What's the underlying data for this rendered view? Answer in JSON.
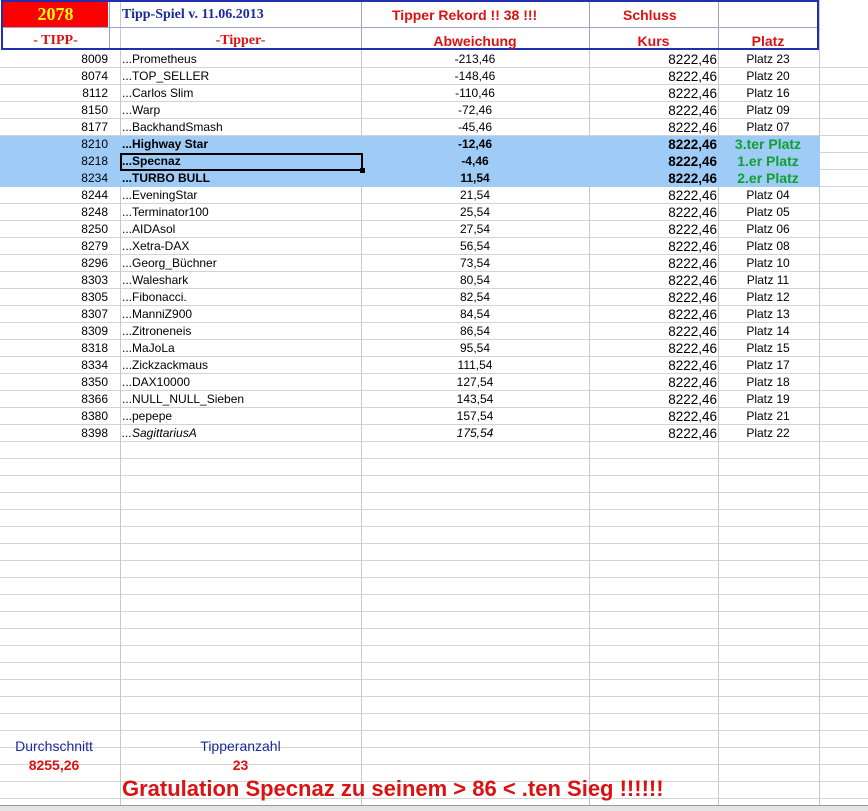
{
  "header": {
    "tipp_count_box": "2078",
    "title": "Tipp-Spiel v. 11.06.2013",
    "record": "Tipper Rekord !!  38  !!!",
    "close_label": "Schluss",
    "col_tipp": "- TIPP-",
    "col_tipper": "-Tipper-",
    "col_deviation": "Abweichung",
    "col_course": "Kurs",
    "col_place": "Platz"
  },
  "rows": [
    {
      "tipp": "8009",
      "name": "...Prometheus",
      "dev": "-213,46",
      "kurs": "8222,46",
      "platz": "Platz 23"
    },
    {
      "tipp": "8074",
      "name": "...TOP_SELLER",
      "dev": "-148,46",
      "kurs": "8222,46",
      "platz": "Platz 20"
    },
    {
      "tipp": "8112",
      "name": "...Carlos Slim",
      "dev": "-110,46",
      "kurs": "8222,46",
      "platz": "Platz 16"
    },
    {
      "tipp": "8150",
      "name": "...Warp",
      "dev": "-72,46",
      "kurs": "8222,46",
      "platz": "Platz 09"
    },
    {
      "tipp": "8177",
      "name": "...BackhandSmash",
      "dev": "-45,46",
      "kurs": "8222,46",
      "platz": "Platz 07"
    },
    {
      "tipp": "8210",
      "name": "...Highway Star",
      "dev": "-12,46",
      "kurs": "8222,46",
      "platz": "3.ter Platz"
    },
    {
      "tipp": "8218",
      "name": "...Specnaz",
      "dev": "-4,46",
      "kurs": "8222,46",
      "platz": "1.er Platz"
    },
    {
      "tipp": "8234",
      "name": "...TURBO BULL",
      "dev": "11,54",
      "kurs": "8222,46",
      "platz": "2.er Platz"
    },
    {
      "tipp": "8244",
      "name": "...EveningStar",
      "dev": "21,54",
      "kurs": "8222,46",
      "platz": "Platz 04"
    },
    {
      "tipp": "8248",
      "name": "...Terminator100",
      "dev": "25,54",
      "kurs": "8222,46",
      "platz": "Platz 05"
    },
    {
      "tipp": "8250",
      "name": "...AIDAsol",
      "dev": "27,54",
      "kurs": "8222,46",
      "platz": "Platz 06"
    },
    {
      "tipp": "8279",
      "name": "...Xetra-DAX",
      "dev": "56,54",
      "kurs": "8222,46",
      "platz": "Platz 08"
    },
    {
      "tipp": "8296",
      "name": "...Georg_Büchner",
      "dev": "73,54",
      "kurs": "8222,46",
      "platz": "Platz 10"
    },
    {
      "tipp": "8303",
      "name": "...Waleshark",
      "dev": "80,54",
      "kurs": "8222,46",
      "platz": "Platz 11"
    },
    {
      "tipp": "8305",
      "name": "...Fibonacci.",
      "dev": "82,54",
      "kurs": "8222,46",
      "platz": "Platz 12"
    },
    {
      "tipp": "8307",
      "name": "...ManniZ900",
      "dev": "84,54",
      "kurs": "8222,46",
      "platz": "Platz 13"
    },
    {
      "tipp": "8309",
      "name": "...Zitroneneis",
      "dev": "86,54",
      "kurs": "8222,46",
      "platz": "Platz 14"
    },
    {
      "tipp": "8318",
      "name": "...MaJoLa",
      "dev": "95,54",
      "kurs": "8222,46",
      "platz": "Platz 15"
    },
    {
      "tipp": "8334",
      "name": "...Zickzackmaus",
      "dev": "111,54",
      "kurs": "8222,46",
      "platz": "Platz 17"
    },
    {
      "tipp": "8350",
      "name": "...DAX10000",
      "dev": "127,54",
      "kurs": "8222,46",
      "platz": "Platz 18"
    },
    {
      "tipp": "8366",
      "name": "...NULL_NULL_Sieben",
      "dev": "143,54",
      "kurs": "8222,46",
      "platz": "Platz 19"
    },
    {
      "tipp": "8380",
      "name": "...pepepe",
      "dev": "157,54",
      "kurs": "8222,46",
      "platz": "Platz 21"
    },
    {
      "tipp": "8398",
      "name": "...SagittariusA",
      "dev": "175,54",
      "kurs": "8222,46",
      "platz": "Platz 22"
    }
  ],
  "footer": {
    "avg_label": "Durchschnitt",
    "avg_value": "8255,26",
    "count_label": "Tipperanzahl",
    "count_value": "23",
    "congrats": "Gratulation Specnaz  zu seinem > 86 < .ten Sieg !!!!!!"
  },
  "colors": {
    "frame": "#2030b0",
    "title_red": "#dd1111",
    "highlight_row": "#9fcbf7",
    "win_green": "#10a030",
    "year_box_bg": "#ff0000",
    "year_box_fg": "#ffff00"
  }
}
